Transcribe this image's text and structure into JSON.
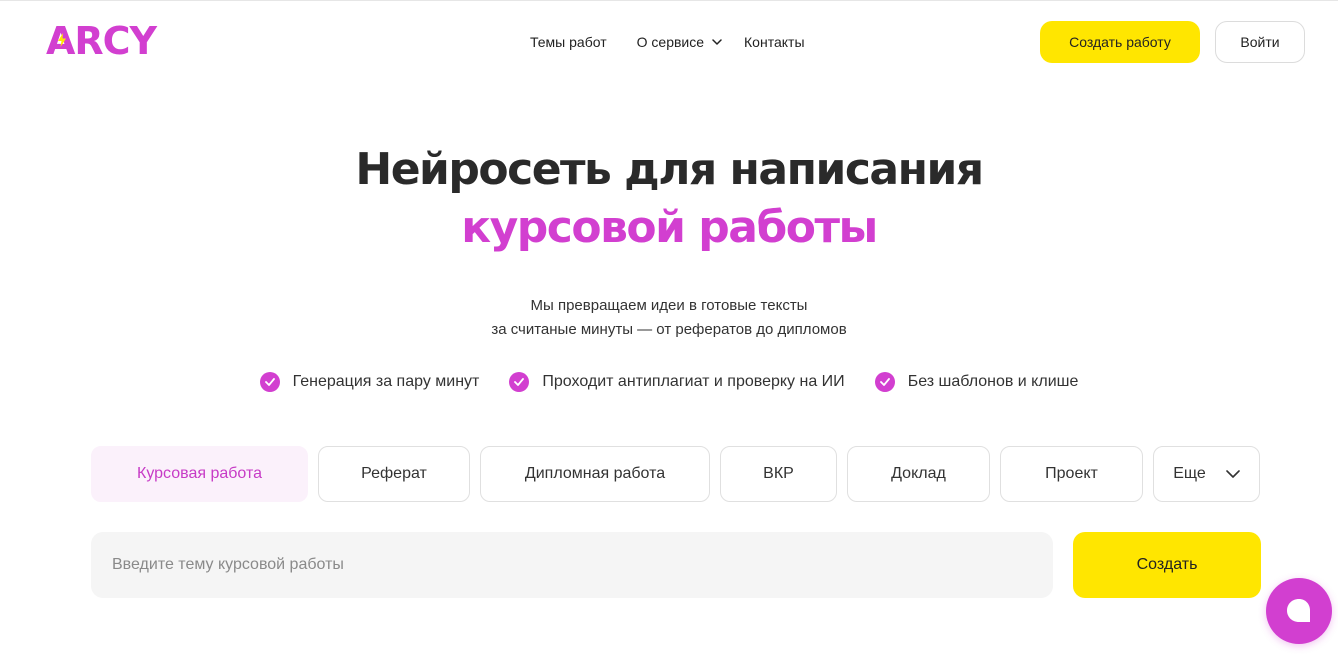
{
  "colors": {
    "brand": "#d23fd0",
    "accent_yellow": "#ffe600",
    "active_tab_bg": "#fbf1fb",
    "text": "#222222"
  },
  "header": {
    "logo": "ARCY",
    "nav": [
      {
        "label": "Темы работ"
      },
      {
        "label": "О сервисе",
        "icon": "chevron-down-icon"
      },
      {
        "label": "Контакты"
      }
    ],
    "create_label": "Создать работу",
    "login_label": "Войти"
  },
  "hero": {
    "title_line1": "Нейросеть для написания",
    "title_line2": "курсовой работы",
    "subtitle_line1": "Мы превращаем идеи в готовые тексты",
    "subtitle_line2": "за считаные минуты — от рефератов до дипломов",
    "features": [
      "Генерация за пару минут",
      "Проходит антиплагиат и проверку на ИИ",
      "Без шаблонов и клише"
    ]
  },
  "tabs": [
    {
      "label": "Курсовая работа",
      "active": true
    },
    {
      "label": "Реферат",
      "active": false
    },
    {
      "label": "Дипломная работа",
      "active": false
    },
    {
      "label": "ВКР",
      "active": false
    },
    {
      "label": "Доклад",
      "active": false
    },
    {
      "label": "Проект",
      "active": false
    },
    {
      "label": "Еще",
      "active": false,
      "icon": "chevron-down-icon"
    }
  ],
  "topic": {
    "value": "",
    "placeholder": "Введите тему курсовой работы",
    "submit_label": "Создать"
  },
  "chat": {
    "icon": "chat-bubble-icon"
  }
}
